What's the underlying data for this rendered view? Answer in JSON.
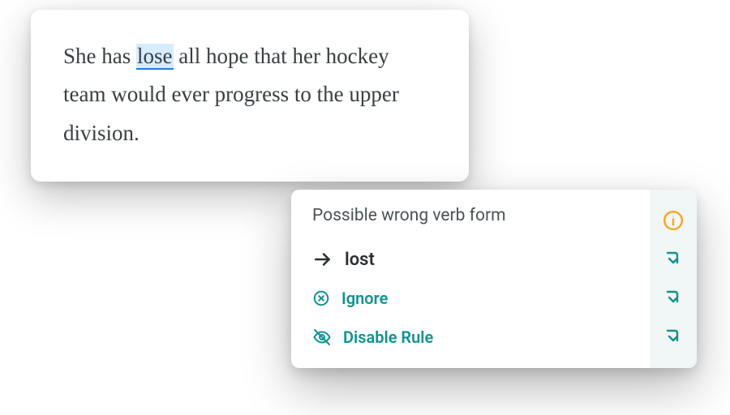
{
  "editor": {
    "before": "She has ",
    "highlight": "lose",
    "after": " all hope that her hockey team would ever progress to the upper division."
  },
  "popup": {
    "title": "Possible wrong verb form",
    "suggestion": "lost",
    "ignore_label": "Ignore",
    "disable_label": "Disable Rule"
  },
  "colors": {
    "teal": "#0f9391",
    "orange": "#f5a623",
    "text": "#3a3f42"
  }
}
